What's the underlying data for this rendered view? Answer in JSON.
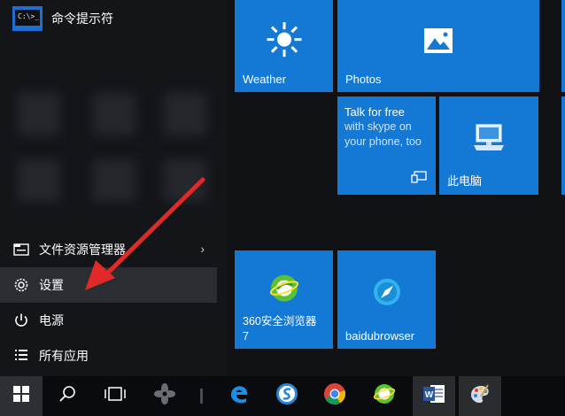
{
  "recent_app": {
    "label": "命令提示符",
    "icon_text": "C:\\>_"
  },
  "sidebar": {
    "items": [
      {
        "label": "文件资源管理器",
        "icon": "folder-icon",
        "has_chevron": true,
        "chevron": "›"
      },
      {
        "label": "设置",
        "icon": "gear-icon",
        "selected": true
      },
      {
        "label": "电源",
        "icon": "power-icon"
      },
      {
        "label": "所有应用",
        "icon": "list-icon"
      }
    ]
  },
  "tiles": {
    "weather": {
      "label": "Weather",
      "icon": "sun-icon"
    },
    "photos": {
      "label": "Photos",
      "icon": "photo-icon"
    },
    "skype": {
      "label": "Talk for free with skype on your phone, too",
      "title": "Talk for free",
      "body": "with skype on your phone, too",
      "icon": "skype-app-icon"
    },
    "this_pc": {
      "label": "此电脑",
      "icon": "computer-icon"
    },
    "browser_360": {
      "label": "360安全浏览器 7",
      "line1": "360安全浏览器",
      "line2": "7",
      "icon": "360-browser-icon"
    },
    "baidu": {
      "label": "baidubrowser",
      "icon": "baidu-browser-icon"
    }
  },
  "taskbar": {
    "items": [
      {
        "name": "start-button",
        "icon": "windows-logo-icon"
      },
      {
        "name": "search-button",
        "icon": "search-icon"
      },
      {
        "name": "task-view-button",
        "icon": "task-view-icon"
      },
      {
        "name": "fan-app",
        "icon": "fan-icon"
      },
      {
        "name": "edge-app",
        "icon": "edge-icon"
      },
      {
        "name": "sogou-app",
        "icon": "s-browser-icon"
      },
      {
        "name": "chrome-app",
        "icon": "chrome-icon"
      },
      {
        "name": "360-browser-app",
        "icon": "360-browser-icon"
      },
      {
        "name": "word-app",
        "icon": "word-icon"
      },
      {
        "name": "paint-app",
        "icon": "paint-icon"
      }
    ]
  },
  "colors": {
    "tile_blue": "#1479d4",
    "arrow_red": "#e02a2a",
    "background": "#111317"
  }
}
